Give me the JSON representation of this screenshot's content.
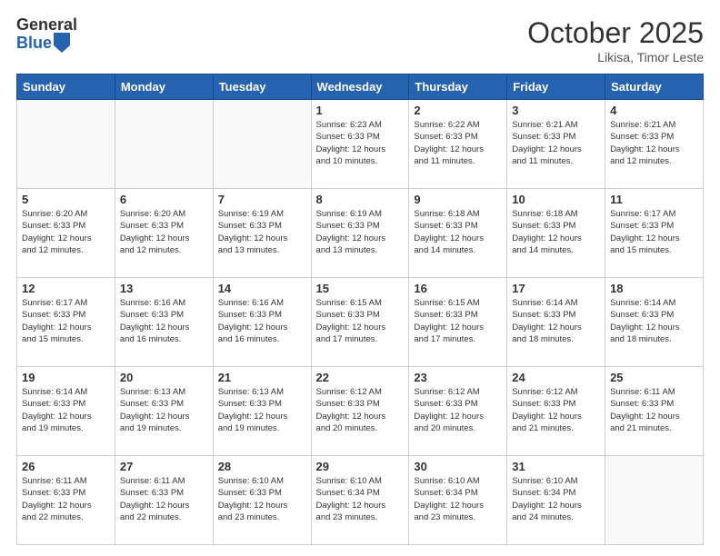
{
  "logo": {
    "general": "General",
    "blue": "Blue"
  },
  "header": {
    "month": "October 2025",
    "location": "Likisa, Timor Leste"
  },
  "weekdays": [
    "Sunday",
    "Monday",
    "Tuesday",
    "Wednesday",
    "Thursday",
    "Friday",
    "Saturday"
  ],
  "weeks": [
    [
      {
        "day": "",
        "info": ""
      },
      {
        "day": "",
        "info": ""
      },
      {
        "day": "",
        "info": ""
      },
      {
        "day": "1",
        "info": "Sunrise: 6:23 AM\nSunset: 6:33 PM\nDaylight: 12 hours\nand 10 minutes."
      },
      {
        "day": "2",
        "info": "Sunrise: 6:22 AM\nSunset: 6:33 PM\nDaylight: 12 hours\nand 11 minutes."
      },
      {
        "day": "3",
        "info": "Sunrise: 6:21 AM\nSunset: 6:33 PM\nDaylight: 12 hours\nand 11 minutes."
      },
      {
        "day": "4",
        "info": "Sunrise: 6:21 AM\nSunset: 6:33 PM\nDaylight: 12 hours\nand 12 minutes."
      }
    ],
    [
      {
        "day": "5",
        "info": "Sunrise: 6:20 AM\nSunset: 6:33 PM\nDaylight: 12 hours\nand 12 minutes."
      },
      {
        "day": "6",
        "info": "Sunrise: 6:20 AM\nSunset: 6:33 PM\nDaylight: 12 hours\nand 12 minutes."
      },
      {
        "day": "7",
        "info": "Sunrise: 6:19 AM\nSunset: 6:33 PM\nDaylight: 12 hours\nand 13 minutes."
      },
      {
        "day": "8",
        "info": "Sunrise: 6:19 AM\nSunset: 6:33 PM\nDaylight: 12 hours\nand 13 minutes."
      },
      {
        "day": "9",
        "info": "Sunrise: 6:18 AM\nSunset: 6:33 PM\nDaylight: 12 hours\nand 14 minutes."
      },
      {
        "day": "10",
        "info": "Sunrise: 6:18 AM\nSunset: 6:33 PM\nDaylight: 12 hours\nand 14 minutes."
      },
      {
        "day": "11",
        "info": "Sunrise: 6:17 AM\nSunset: 6:33 PM\nDaylight: 12 hours\nand 15 minutes."
      }
    ],
    [
      {
        "day": "12",
        "info": "Sunrise: 6:17 AM\nSunset: 6:33 PM\nDaylight: 12 hours\nand 15 minutes."
      },
      {
        "day": "13",
        "info": "Sunrise: 6:16 AM\nSunset: 6:33 PM\nDaylight: 12 hours\nand 16 minutes."
      },
      {
        "day": "14",
        "info": "Sunrise: 6:16 AM\nSunset: 6:33 PM\nDaylight: 12 hours\nand 16 minutes."
      },
      {
        "day": "15",
        "info": "Sunrise: 6:15 AM\nSunset: 6:33 PM\nDaylight: 12 hours\nand 17 minutes."
      },
      {
        "day": "16",
        "info": "Sunrise: 6:15 AM\nSunset: 6:33 PM\nDaylight: 12 hours\nand 17 minutes."
      },
      {
        "day": "17",
        "info": "Sunrise: 6:14 AM\nSunset: 6:33 PM\nDaylight: 12 hours\nand 18 minutes."
      },
      {
        "day": "18",
        "info": "Sunrise: 6:14 AM\nSunset: 6:33 PM\nDaylight: 12 hours\nand 18 minutes."
      }
    ],
    [
      {
        "day": "19",
        "info": "Sunrise: 6:14 AM\nSunset: 6:33 PM\nDaylight: 12 hours\nand 19 minutes."
      },
      {
        "day": "20",
        "info": "Sunrise: 6:13 AM\nSunset: 6:33 PM\nDaylight: 12 hours\nand 19 minutes."
      },
      {
        "day": "21",
        "info": "Sunrise: 6:13 AM\nSunset: 6:33 PM\nDaylight: 12 hours\nand 19 minutes."
      },
      {
        "day": "22",
        "info": "Sunrise: 6:12 AM\nSunset: 6:33 PM\nDaylight: 12 hours\nand 20 minutes."
      },
      {
        "day": "23",
        "info": "Sunrise: 6:12 AM\nSunset: 6:33 PM\nDaylight: 12 hours\nand 20 minutes."
      },
      {
        "day": "24",
        "info": "Sunrise: 6:12 AM\nSunset: 6:33 PM\nDaylight: 12 hours\nand 21 minutes."
      },
      {
        "day": "25",
        "info": "Sunrise: 6:11 AM\nSunset: 6:33 PM\nDaylight: 12 hours\nand 21 minutes."
      }
    ],
    [
      {
        "day": "26",
        "info": "Sunrise: 6:11 AM\nSunset: 6:33 PM\nDaylight: 12 hours\nand 22 minutes."
      },
      {
        "day": "27",
        "info": "Sunrise: 6:11 AM\nSunset: 6:33 PM\nDaylight: 12 hours\nand 22 minutes."
      },
      {
        "day": "28",
        "info": "Sunrise: 6:10 AM\nSunset: 6:33 PM\nDaylight: 12 hours\nand 23 minutes."
      },
      {
        "day": "29",
        "info": "Sunrise: 6:10 AM\nSunset: 6:34 PM\nDaylight: 12 hours\nand 23 minutes."
      },
      {
        "day": "30",
        "info": "Sunrise: 6:10 AM\nSunset: 6:34 PM\nDaylight: 12 hours\nand 23 minutes."
      },
      {
        "day": "31",
        "info": "Sunrise: 6:10 AM\nSunset: 6:34 PM\nDaylight: 12 hours\nand 24 minutes."
      },
      {
        "day": "",
        "info": ""
      }
    ]
  ]
}
